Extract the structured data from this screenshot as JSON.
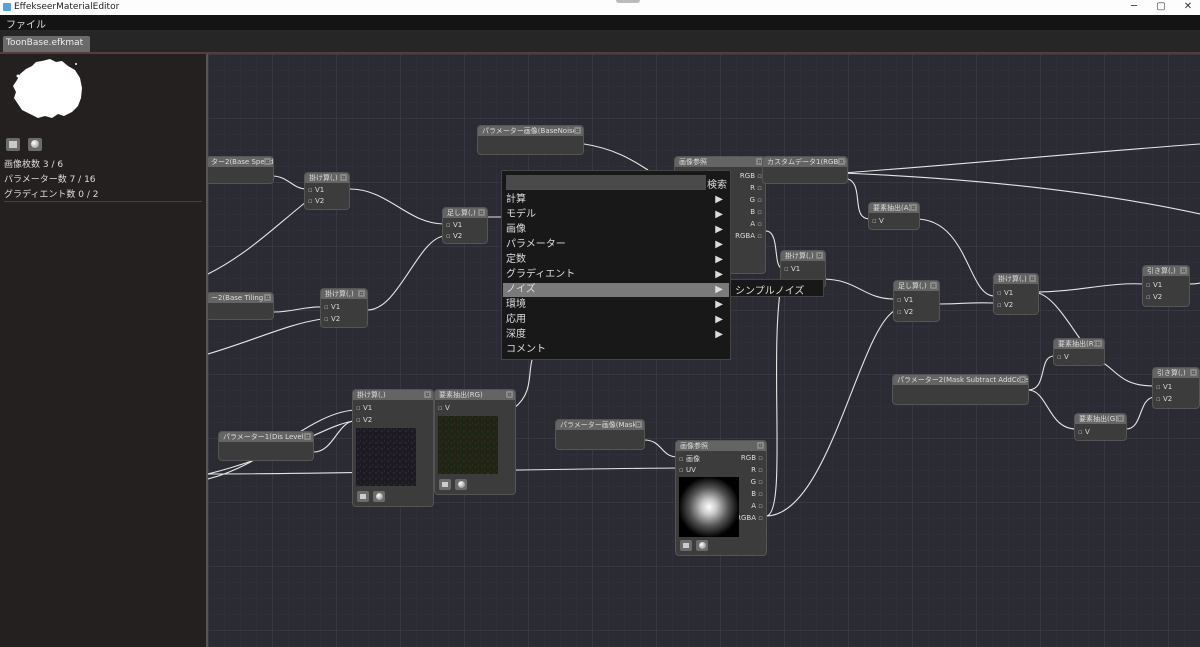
{
  "window": {
    "title": "EffekseerMaterialEditor",
    "minimize": "─",
    "maximize": "▢",
    "close": "✕"
  },
  "menubar": {
    "file": "ファイル"
  },
  "tab": {
    "name": "ToonBase.efkmat"
  },
  "left_panel": {
    "image_count": "画像枚数 3 / 6",
    "param_count": "パラメーター数 7 / 16",
    "gradient_count": "グラディエント数 0 / 2"
  },
  "nodes": {
    "param_base_noise": {
      "title": "パラメーター画像(BaseNoise)"
    },
    "param_base_speed": {
      "title": "ター2(Base Speed)"
    },
    "mul_1": {
      "title": "掛け算(,)",
      "v1": "V1",
      "v2": "V2"
    },
    "add_1": {
      "title": "足し算(,)",
      "v1": "V1",
      "v2": "V2"
    },
    "param_base_tiling": {
      "title": "ー2(Base Tiling)"
    },
    "mul_2": {
      "title": "掛け算(,)",
      "v1": "V1",
      "v2": "V2"
    },
    "tex_ref_top": {
      "title": "画像参照",
      "rgb": "RGB",
      "r": "R",
      "g": "G",
      "b": "B",
      "a": "A",
      "rgba": "RGBA"
    },
    "custom_data": {
      "title": "カスタムデータ1(RGBA)"
    },
    "extract_a": {
      "title": "要素抽出(A)",
      "v": "V"
    },
    "mul_3": {
      "title": "掛け算(,)",
      "v1": "V1"
    },
    "add_2": {
      "title": "足し算(,)",
      "v1": "V1",
      "v2": "V2"
    },
    "mul_4": {
      "title": "掛け算(,)",
      "v1": "V1",
      "v2": "V2"
    },
    "sub_1": {
      "title": "引き算(,)",
      "v1": "V1",
      "v2": "V2"
    },
    "extract_r": {
      "title": "要素抽出(R)",
      "v": "V"
    },
    "param_mask_sub": {
      "title": "パラメーター2(Mask Subtract AddCore)"
    },
    "extract_g": {
      "title": "要素抽出(G)",
      "v": "V"
    },
    "sub_2": {
      "title": "引き算(,)",
      "v1": "V1",
      "v2": "V2"
    },
    "param_dis_level": {
      "title": "パラメーター1(Dis Level)"
    },
    "mul_5": {
      "title": "掛け算(,)",
      "v1": "V1",
      "v2": "V2"
    },
    "extract_rg": {
      "title": "要素抽出(RG)",
      "v": "V"
    },
    "param_mask": {
      "title": "パラメーター画像(Mask)"
    },
    "tex_ref_bottom": {
      "title": "画像参照",
      "image": "画像",
      "uv": "UV",
      "rgb": "RGB",
      "r": "R",
      "g": "G",
      "b": "B",
      "a": "A",
      "rgba": "RGBA"
    }
  },
  "context_menu": {
    "search_label": "検索",
    "items": [
      "計算",
      "モデル",
      "画像",
      "パラメーター",
      "定数",
      "グラディエント",
      "ノイズ",
      "環境",
      "応用",
      "深度",
      "コメント"
    ],
    "highlighted": "ノイズ",
    "submenu": [
      "シンプルノイズ"
    ]
  },
  "colors": {
    "canvas_bg": "#2b2b33",
    "node_bg": "#3c3c3c",
    "node_header": "#646464",
    "menu_bg": "#181818",
    "menu_highlight": "#7a7a7a",
    "link": "#e6e6e6"
  }
}
